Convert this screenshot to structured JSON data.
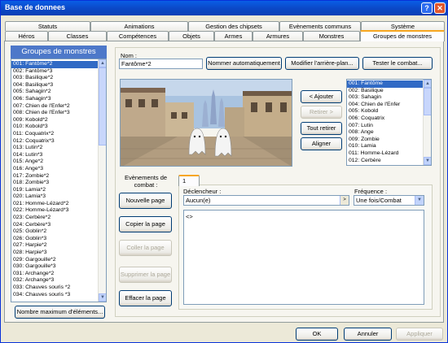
{
  "window": {
    "title": "Base de donnees",
    "help_glyph": "?",
    "close_glyph": "✕"
  },
  "tabs_row1": [
    "Statuts",
    "Animations",
    "Gestion des chipsets",
    "Evènements communs",
    "Système"
  ],
  "tabs_row2": [
    "Héros",
    "Classes",
    "Compétences",
    "Objets",
    "Armes",
    "Armures",
    "Monstres",
    "Groupes de monstres"
  ],
  "active_tab": "Groupes de monstres",
  "list": {
    "header": "Groupes de monstres",
    "items": [
      "001: Fantôme*2",
      "002: Fantôme*3",
      "003: Basilique*2",
      "004: Basilique*3",
      "005: Sahagin*2",
      "006: Sahagin*3",
      "007: Chien de l'Enfer*2",
      "008: Chien de l'Enfer*3",
      "009: Kobold*2",
      "010: Kobold*3",
      "011: Coquatrix*2",
      "012: Coquatrix*3",
      "013: Lutin*2",
      "014: Lutin*3",
      "015: Ange*2",
      "016: Ange*3",
      "017: Zombie*2",
      "018: Zombie*3",
      "019: Lamia*2",
      "020: Lamia*3",
      "021: Homme-Lézard*2",
      "022: Homme-Lézard*3",
      "023: Cerbère*2",
      "024: Cerbère*3",
      "025: Goblin*2",
      "026: Goblin*3",
      "027: Harpie*2",
      "028: Harpie*3",
      "029: Gargouille*2",
      "030: Gargouille*3",
      "031: Archange*2",
      "032: Archange*3",
      "033: Chauves souris *2",
      "034: Chauves souris *3"
    ],
    "selected_index": 0,
    "max_button": "Nombre maximum d'éléments..."
  },
  "name_label": "Nom :",
  "name_value": "Fantôme*2",
  "buttons": {
    "auto_name": "Nommer automatiquement",
    "change_bg": "Modifier l'arrière-plan...",
    "test_battle": "Tester le combat...",
    "add": "< Ajouter",
    "remove": "Retirer >",
    "remove_all": "Tout retirer",
    "align": "Aligner",
    "new_page": "Nouvelle page",
    "copy_page": "Copier la page",
    "paste_page": "Coller la page",
    "delete_page": "Supprimer la page",
    "clear_page": "Effacer la page",
    "ok": "OK",
    "cancel": "Annuler",
    "apply": "Appliquer"
  },
  "monsters": {
    "items": [
      "001: Fantôme",
      "002: Basilique",
      "003: Sahagin",
      "004: Chien de l'Enfer",
      "005: Kobold",
      "006: Coquatrix",
      "007: Lutin",
      "008: Ange",
      "009: Zombie",
      "010: Lamia",
      "011: Homme-Lézard",
      "012: Cerbère"
    ],
    "selected_index": 0
  },
  "events": {
    "label": "Evènements de combat :",
    "page_tab": "1",
    "trigger_label": "Déclencheur :",
    "trigger_value": "Aucun(e)",
    "freq_label": "Fréquence :",
    "freq_value": "Une fois/Combat",
    "command": "<>"
  },
  "colors": {
    "selection": "#316ac5",
    "titlebar": "#0a5ee6",
    "tab_highlight": "#f7a620"
  }
}
